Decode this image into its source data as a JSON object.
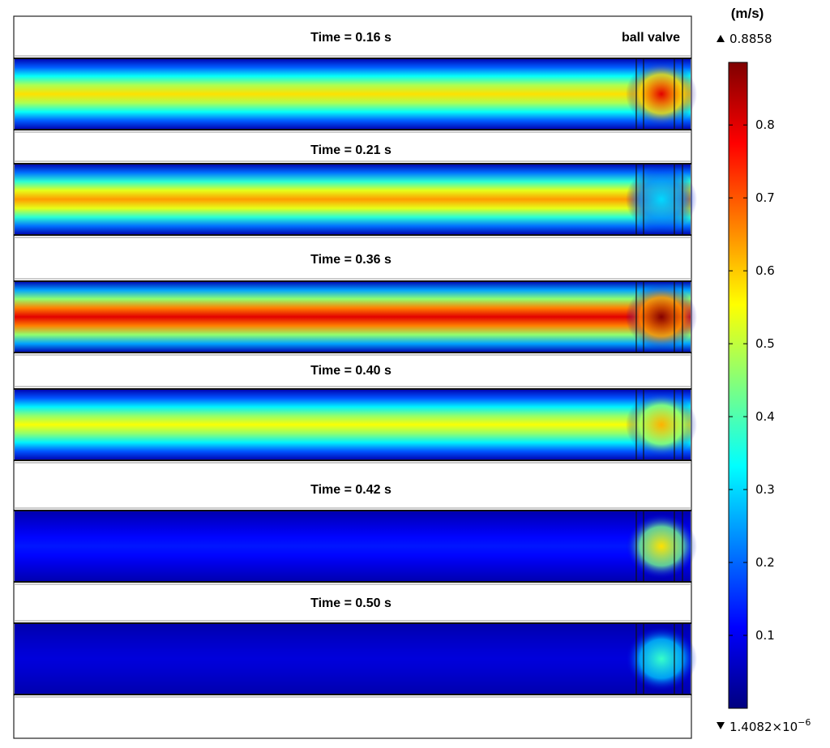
{
  "chart_data": {
    "type": "heatmap",
    "title": "",
    "quantity_unit": "(m/s)",
    "annotation": "ball valve",
    "colormap": "rainbow",
    "colormap_stops": [
      "#00007f",
      "#0000ff",
      "#007fff",
      "#00ffff",
      "#7fff7f",
      "#ffff00",
      "#ff7f00",
      "#ff0000",
      "#7f0000"
    ],
    "range": {
      "min": 1.4082e-06,
      "max": 0.8858
    },
    "max_label": "0.8858",
    "min_label_mantissa": "1.4082",
    "min_label_base": "×10",
    "min_label_exp": "−6",
    "colorbar_ticks": [
      "0.1",
      "0.2",
      "0.3",
      "0.4",
      "0.5",
      "0.6",
      "0.7",
      "0.8"
    ],
    "colorbar_tick_values": [
      0.1,
      0.2,
      0.3,
      0.4,
      0.5,
      0.6,
      0.7,
      0.8
    ],
    "panels": [
      {
        "label": "Time = 0.16 s",
        "time_s": 0.16,
        "core_velocity": 0.58,
        "valve_velocity": 0.8
      },
      {
        "label": "Time = 0.21 s",
        "time_s": 0.21,
        "core_velocity": 0.64,
        "valve_velocity": 0.3
      },
      {
        "label": "Time = 0.36 s",
        "time_s": 0.36,
        "core_velocity": 0.8,
        "valve_velocity": 0.88
      },
      {
        "label": "Time = 0.40 s",
        "time_s": 0.4,
        "core_velocity": 0.55,
        "valve_velocity": 0.62
      },
      {
        "label": "Time = 0.42 s",
        "time_s": 0.42,
        "core_velocity": 0.13,
        "valve_velocity": 0.58
      },
      {
        "label": "Time = 0.50 s",
        "time_s": 0.5,
        "core_velocity": 0.08,
        "valve_velocity": 0.38
      }
    ]
  }
}
